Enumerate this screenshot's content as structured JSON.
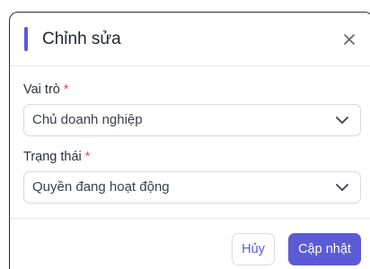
{
  "colors": {
    "accent": "#5b5bd6",
    "required": "#e5484d",
    "text": "#222633"
  },
  "dialog": {
    "title": "Chỉnh sửa",
    "close_icon": "close-icon"
  },
  "form": {
    "role": {
      "label": "Vai trò",
      "required_mark": "*",
      "value": "Chủ doanh nghiệp",
      "icon": "chevron-down-icon"
    },
    "status": {
      "label": "Trạng thái",
      "required_mark": "*",
      "value": "Quyền đang hoạt động",
      "icon": "chevron-down-icon"
    }
  },
  "footer": {
    "cancel_label": "Hủy",
    "submit_label": "Cập nhật"
  }
}
